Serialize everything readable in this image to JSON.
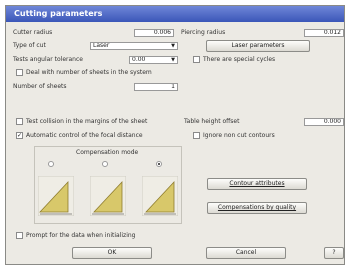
{
  "window": {
    "title": "Cutting parameters"
  },
  "fields": {
    "cutter_radius_label": "Cutter radius",
    "cutter_radius_value": "0.006",
    "piercing_radius_label": "Piercing radius",
    "piercing_radius_value": "0.012",
    "type_of_cut_label": "Type of cut",
    "type_of_cut_value": "Laser",
    "tests_angular_label": "Tests angular tolerance",
    "tests_angular_value": "0.00",
    "number_of_sheets_label": "Number of sheets",
    "number_of_sheets_value": "1",
    "table_height_label": "Table height offset",
    "table_height_value": "0.000"
  },
  "buttons": {
    "laser_parameters": "Laser parameters",
    "contour_attributes": "Contour attributes",
    "compensations_by_quality": "Compensations by quality",
    "ok": "OK",
    "cancel": "Cancel",
    "help": "?"
  },
  "checkboxes": {
    "special_cycles": "There are special cycles",
    "deal_number_sheets": "Deal with number of sheets in the system",
    "test_collision": "Test collision in the margins of the sheet",
    "automatic_focal": "Automatic control of the focal distance",
    "ignore_non_cut": "Ignore non cut contours",
    "prompt_data": "Prompt for the data when initializing"
  },
  "checked": {
    "automatic_focal": true
  },
  "compensation": {
    "label": "Compensation mode",
    "selected_index": 2
  },
  "colors": {
    "title_bar": "#3b56b8",
    "icon_triangle": "#d8c86a",
    "window_bg": "#eceae4"
  }
}
